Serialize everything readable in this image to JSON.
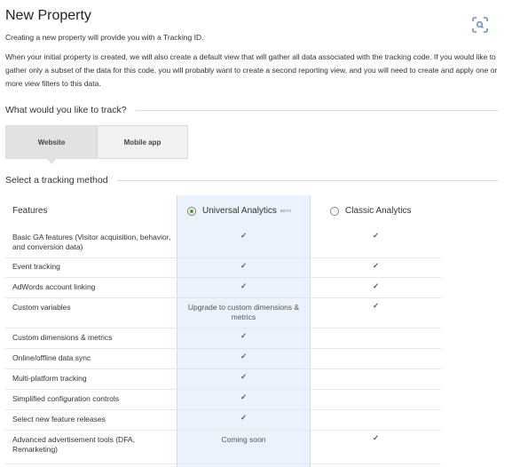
{
  "page": {
    "title": "New Property",
    "intro1": "Creating a new property will provide you with a Tracking ID.",
    "intro2": "When your initial property is created, we will also create a default view that will gather all data associated with the tracking code. If you would like to gather only a subset of the data for this code, you will probably want to create a second reporting view, and you will need to create and apply one or more view filters to this data."
  },
  "track": {
    "heading": "What would you like to track?",
    "options": [
      "Website",
      "Mobile app"
    ],
    "selected": "Website"
  },
  "method": {
    "heading": "Select a tracking method",
    "features_header": "Features",
    "universal": {
      "label": "Universal Analytics",
      "badge": "BETA",
      "selected": true
    },
    "classic": {
      "label": "Classic Analytics",
      "selected": false
    }
  },
  "rows": [
    {
      "feature": "Basic GA features (Visitor acquisition, behavior, and conversion data)",
      "universal": "✓",
      "classic": "✓"
    },
    {
      "feature": "Event tracking",
      "universal": "✓",
      "classic": "✓"
    },
    {
      "feature": "AdWords account linking",
      "universal": "✓",
      "classic": "✓"
    },
    {
      "feature": "Custom variables",
      "universal": "Upgrade to custom dimensions & metrics",
      "classic": "✓"
    },
    {
      "feature": "Custom dimensions & metrics",
      "universal": "✓",
      "classic": ""
    },
    {
      "feature": "Online/offline data sync",
      "universal": "✓",
      "classic": ""
    },
    {
      "feature": "Multi-platform tracking",
      "universal": "✓",
      "classic": ""
    },
    {
      "feature": "Simplified configuration controls",
      "universal": "✓",
      "classic": ""
    },
    {
      "feature": "Select new feature releases",
      "universal": "✓",
      "classic": ""
    },
    {
      "feature": "Advanced advertisement tools (DFA, Remarketing)",
      "universal": "Coming soon",
      "classic": "✓"
    }
  ],
  "icons": {
    "corner": "lens-scan-icon",
    "check": "checkmark-icon"
  },
  "colors": {
    "check": "#4f9a28",
    "highlight": "#eaf3fb",
    "accent": "#6b8fc7"
  }
}
